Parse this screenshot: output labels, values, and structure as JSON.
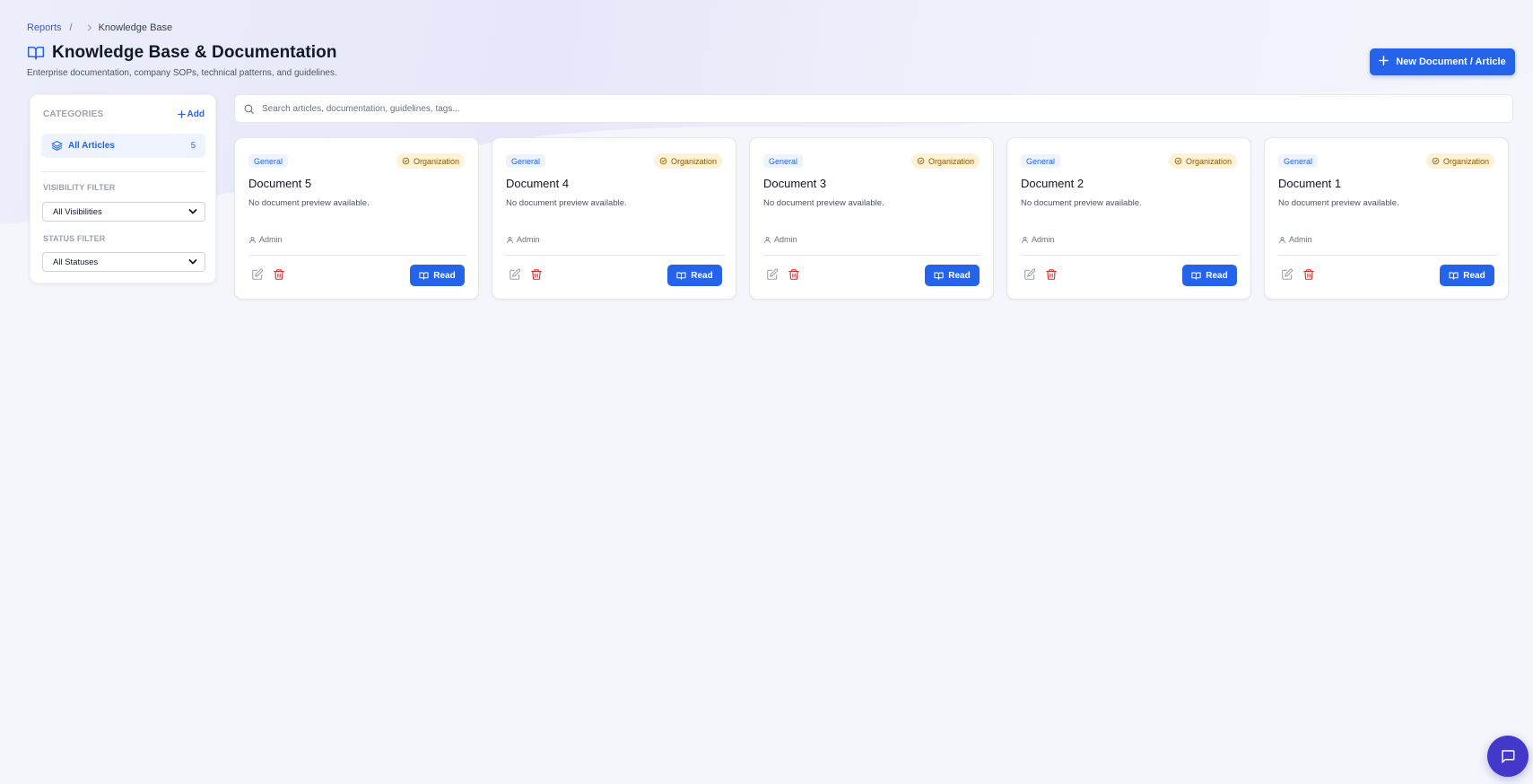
{
  "breadcrumb": {
    "root": "Reports",
    "separator": "/",
    "current": "Knowledge Base"
  },
  "header": {
    "title": "Knowledge Base & Documentation",
    "subtitle": "Enterprise documentation, company SOPs, technical patterns, and guidelines.",
    "new_button_label": "New Document / Article",
    "icon": "book-open-icon"
  },
  "sidebar": {
    "categories_title": "CATEGORIES",
    "add_label": "Add",
    "all_articles": {
      "label": "All Articles",
      "count": "5",
      "icon": "layers-icon"
    },
    "visibility_filter": {
      "label": "VISIBILITY FILTER",
      "value": "All Visibilities"
    },
    "status_filter": {
      "label": "STATUS FILTER",
      "value": "All Statuses"
    }
  },
  "search": {
    "placeholder": "Search articles, documentation, guidelines, tags..."
  },
  "cards": [
    {
      "category": "General",
      "visibility": "Organization",
      "title": "Document 5",
      "preview": "No document preview available.",
      "author": "Admin",
      "read_label": "Read"
    },
    {
      "category": "General",
      "visibility": "Organization",
      "title": "Document 4",
      "preview": "No document preview available.",
      "author": "Admin",
      "read_label": "Read"
    },
    {
      "category": "General",
      "visibility": "Organization",
      "title": "Document 3",
      "preview": "No document preview available.",
      "author": "Admin",
      "read_label": "Read"
    },
    {
      "category": "General",
      "visibility": "Organization",
      "title": "Document 2",
      "preview": "No document preview available.",
      "author": "Admin",
      "read_label": "Read"
    },
    {
      "category": "General",
      "visibility": "Organization",
      "title": "Document 1",
      "preview": "No document preview available.",
      "author": "Admin",
      "read_label": "Read"
    }
  ],
  "colors": {
    "primary": "#2563eb",
    "danger": "#dc2626",
    "tag_org_bg": "#fdf1d6",
    "tag_org_text": "#8a5a00",
    "chat_fab": "#4338ca"
  },
  "chat": {
    "icon": "chat-bubble-icon"
  }
}
